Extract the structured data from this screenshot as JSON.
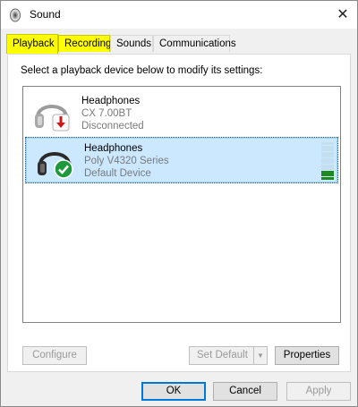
{
  "window": {
    "title": "Sound",
    "close_glyph": "✕"
  },
  "tabs": [
    {
      "label": "Playback"
    },
    {
      "label": "Recording"
    },
    {
      "label": "Sounds"
    },
    {
      "label": "Communications"
    }
  ],
  "instruction": "Select a playback device below to modify its settings:",
  "devices": [
    {
      "name": "Headphones",
      "model": "CX 7.00BT",
      "status": "Disconnected",
      "badge": "disconnected-arrow-icon",
      "selected": false
    },
    {
      "name": "Headphones",
      "model": "Poly V4320 Series",
      "status": "Default Device",
      "badge": "default-check-icon",
      "selected": true,
      "level_meter": "3 of 12 segments lit"
    }
  ],
  "buttons": {
    "configure": "Configure",
    "set_default": "Set Default",
    "properties": "Properties",
    "ok": "OK",
    "cancel": "Cancel",
    "apply": "Apply"
  },
  "colors": {
    "highlight_tab": "#ffff00",
    "selection": "#cce8ff",
    "meter_on": "#1e8a1e",
    "meter_off": "#c5dff2"
  }
}
